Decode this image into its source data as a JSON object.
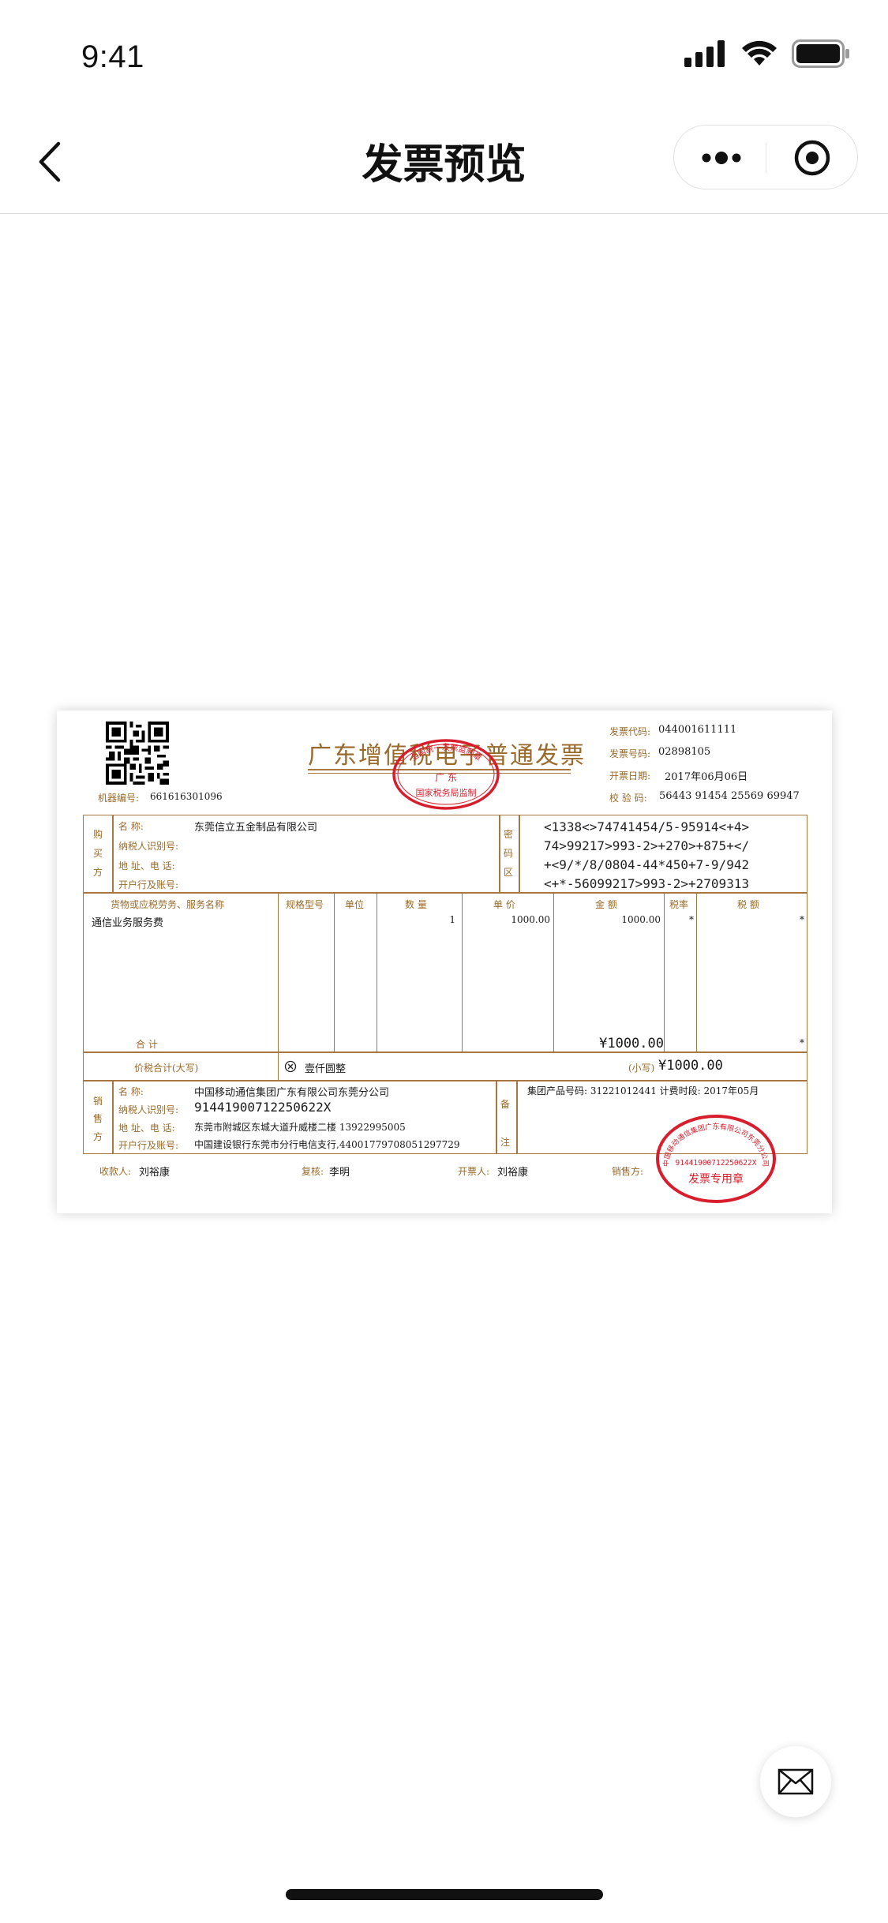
{
  "status_bar": {
    "time": "9:41"
  },
  "nav": {
    "title": "发票预览"
  },
  "icons": {
    "back": "chevron-left-icon",
    "more": "more-dots-icon",
    "close": "target-close-icon",
    "mail": "mail-icon"
  },
  "invoice": {
    "title": "广东增值税电子普通发票",
    "machine_no_label": "机器编号:",
    "machine_no": "661616301096",
    "code_label": "发票代码:",
    "code": "044001611111",
    "number_label": "发票号码:",
    "number": "02898105",
    "date_label": "开票日期:",
    "date": "2017年06月06日",
    "check_label": "校 验 码:",
    "check_code": "56443 91454 25569 69947",
    "buyer": {
      "side_label": [
        "购",
        "买",
        "方"
      ],
      "name_label": "名          称:",
      "name": "东莞信立五金制品有限公司",
      "tax_id_label": "纳税人识别号:",
      "addr_label": "地 址、电 话:",
      "bank_label": "开户行及账号:"
    },
    "cipher": {
      "side_label": [
        "密",
        "码",
        "区"
      ],
      "lines": [
        "<1338<>74741454/5-95914<+4>",
        "74>99217>993-2>+270>+875+</",
        "+<9/*/8/0804-44*450+7-9/942",
        "<+*-56099217>993-2>+2709313"
      ]
    },
    "headers": {
      "item": "货物或应税劳务、服务名称",
      "spec": "规格型号",
      "unit": "单位",
      "qty": "数 量",
      "price": "单 价",
      "amount": "金 额",
      "rate": "税率",
      "tax": "税 额"
    },
    "rows": [
      {
        "item": "通信业务服务费",
        "qty": "1",
        "price": "1000.00",
        "amount": "1000.00",
        "rate": "*",
        "tax": "*"
      }
    ],
    "subtotal_label": "合          计",
    "subtotal_amount": "¥1000.00",
    "subtotal_tax": "*",
    "total_label": "价税合计(大写)",
    "total_upper": "壹仟圆整",
    "total_small_label": "(小写)",
    "total_small": "¥1000.00",
    "seller": {
      "side_label": [
        "销",
        "售",
        "方"
      ],
      "name_label": "名          称:",
      "name": "中国移动通信集团广东有限公司东莞分公司",
      "tax_id_label": "纳税人识别号:",
      "tax_id": "91441900712250622X",
      "addr_label": "地 址、电 话:",
      "addr": "东莞市附城区东城大道升威楼二楼 13922995005",
      "bank_label": "开户行及账号:",
      "bank": "中国建设银行东莞市分行电信支行,44001779708051297729"
    },
    "remark": {
      "side_label": [
        "备",
        "注"
      ],
      "text": "集团产品号码: 31221012441 计费时段: 2017年05月"
    },
    "payee_label": "收款人:",
    "payee": "刘裕康",
    "reviewer_label": "复核:",
    "reviewer": "李明",
    "drawer_label": "开票人:",
    "drawer": "刘裕康",
    "seller_sign_label": "销售方:",
    "seal_center_stamp": {
      "top": "全国统一发票监制章",
      "middle": "广 东",
      "bottom": "国家税务局监制"
    },
    "seal_seller_stamp": {
      "arc": "中国移动通信集团广东有限公司东莞分公司",
      "tax_id": "91441900712250622X",
      "bottom": "发票专用章"
    }
  },
  "colors": {
    "invoice_brown": "#a8773f",
    "stamp_red": "#d81e2c"
  }
}
